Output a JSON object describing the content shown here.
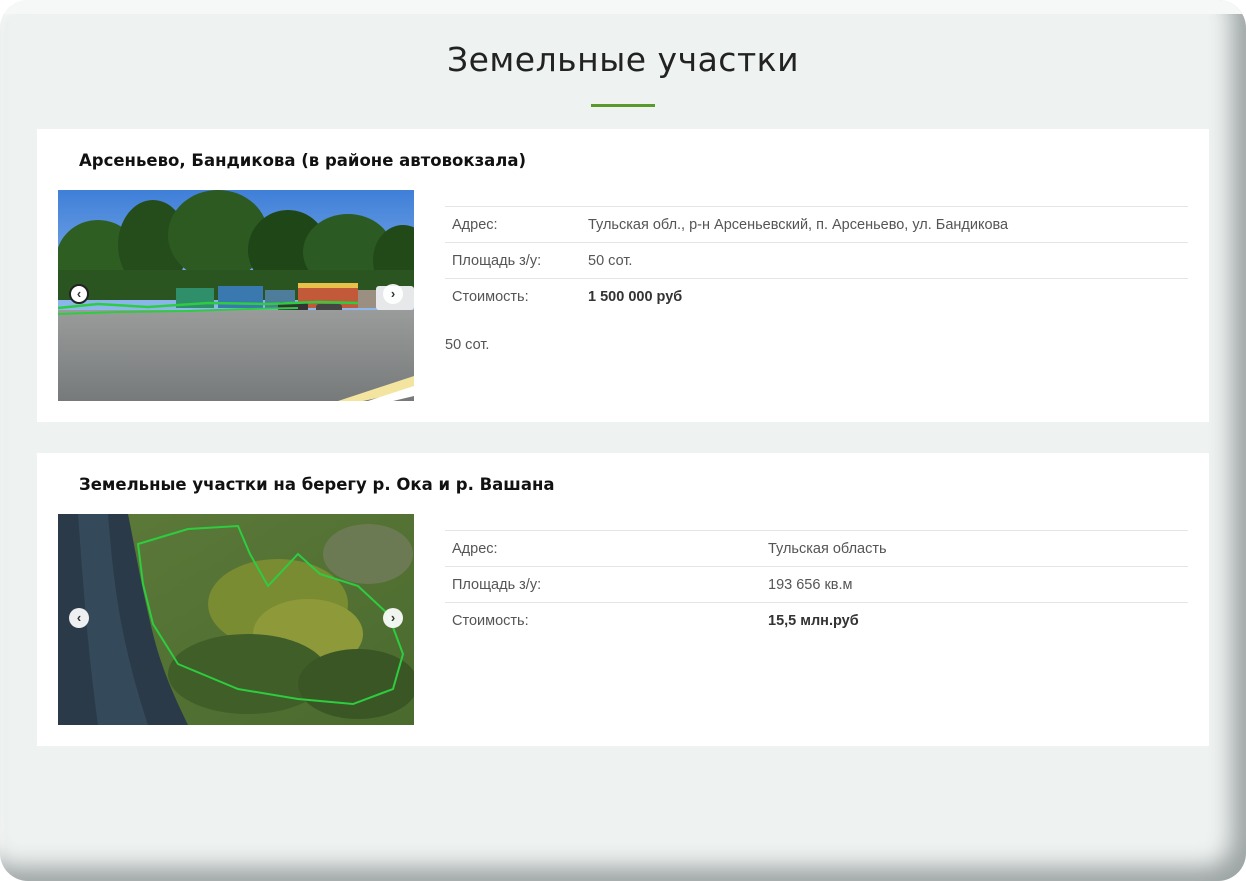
{
  "page": {
    "title": "Земельные участки"
  },
  "listings": [
    {
      "title": "Арсеньево, Бандикова (в районе автовокзала)",
      "address_label": "Адрес:",
      "address_value": "Тульская обл., р-н Арсеньевский, п. Арсеньево, ул. Бандикова",
      "area_label": "Площадь з/у:",
      "area_value": "50 сот.",
      "price_label": "Стоимость:",
      "price_value": "1 500 000 руб",
      "note": "50 сот.",
      "prev_icon": "chevron-left-icon",
      "next_icon": "chevron-right-icon"
    },
    {
      "title": "Земельные участки на берегу р. Ока и р. Вашана",
      "address_label": "Адрес:",
      "address_value": "Тульская область",
      "area_label": "Площадь з/у:",
      "area_value": "193 656 кв.м",
      "price_label": "Стоимость:",
      "price_value": "15,5 млн.руб",
      "prev_icon": "chevron-left-icon",
      "next_icon": "chevron-right-icon"
    }
  ],
  "colors": {
    "accent": "#5a9a2a",
    "boundary": "#2ecc40",
    "background": "#eef2f1"
  }
}
